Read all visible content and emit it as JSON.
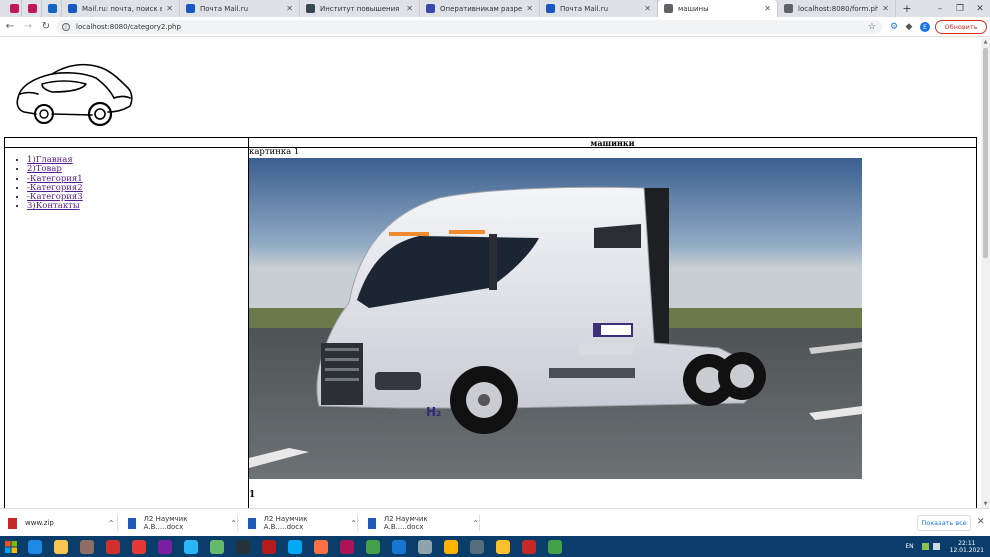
{
  "browser": {
    "tabs": [
      {
        "title": "",
        "color": "#c2185b"
      },
      {
        "title": "",
        "color": "#c2185b"
      },
      {
        "title": "",
        "color": "#1565c0"
      },
      {
        "title": "Mail.ru: почта, поиск в интерн",
        "color": "#1a56c4"
      },
      {
        "title": "Почта Mail.ru",
        "color": "#1a56c4"
      },
      {
        "title": "Институт повышения квалиф",
        "color": "#37474f"
      },
      {
        "title": "Оперативникам разрешен ос",
        "color": "#3949ab"
      },
      {
        "title": "Почта Mail.ru",
        "color": "#1a56c4"
      },
      {
        "title": "машины",
        "color": "#5f6368"
      },
      {
        "title": "localhost:8080/form.php",
        "color": "#5f6368"
      }
    ],
    "active_tab_index": 8,
    "url": "localhost:8080/category2.php",
    "profile_initial": "E",
    "update_label": "Обновить"
  },
  "page": {
    "table_header": "машинки",
    "menu": [
      "1)Главная",
      "2)Товар",
      "-Категория1",
      "-Категория2",
      "-Категория3",
      "3)Контакты"
    ],
    "picture_caption": "картинка 1",
    "footer_number": "1",
    "truck_badge": "H₂"
  },
  "downloads": {
    "items": [
      {
        "name": "www.zip",
        "icon_color": "#c62828"
      },
      {
        "name": "Л2 Наумчик А.В.....docx",
        "icon_color": "#1e5bb8"
      },
      {
        "name": "Л2 Наумчик А.В.....docx",
        "icon_color": "#1e5bb8"
      },
      {
        "name": "Л2 Наумчик А.В.....docx",
        "icon_color": "#1e5bb8"
      }
    ],
    "show_all_label": "Показать все"
  },
  "taskbar": {
    "language": "EN",
    "time": "22:11",
    "date": "12.01.2021",
    "apps": [
      {
        "name": "ie-icon",
        "color": "#1e88e5"
      },
      {
        "name": "explorer-icon",
        "color": "#f9c74f"
      },
      {
        "name": "media-icon",
        "color": "#8d6e63"
      },
      {
        "name": "opera-icon",
        "color": "#d32f2f"
      },
      {
        "name": "opera-gx-icon",
        "color": "#e53935"
      },
      {
        "name": "viber-icon",
        "color": "#7b1fa2"
      },
      {
        "name": "telegram-icon",
        "color": "#29b6f6"
      },
      {
        "name": "notepad-icon",
        "color": "#66bb6a"
      },
      {
        "name": "ccleaner-icon",
        "color": "#263238"
      },
      {
        "name": "recorder-icon",
        "color": "#b71c1c"
      },
      {
        "name": "skype-icon",
        "color": "#03a9f4"
      },
      {
        "name": "firefox-icon",
        "color": "#ff7043"
      },
      {
        "name": "winrar-icon",
        "color": "#ad1457"
      },
      {
        "name": "chrome-icon",
        "color": "#43a047"
      },
      {
        "name": "vscode-icon",
        "color": "#1976d2"
      },
      {
        "name": "settings-icon",
        "color": "#90a4ae"
      },
      {
        "name": "star-icon",
        "color": "#ffb300"
      },
      {
        "name": "photos-icon",
        "color": "#546e7a"
      },
      {
        "name": "paint-icon",
        "color": "#fbc02d"
      },
      {
        "name": "archive-icon",
        "color": "#c62828"
      },
      {
        "name": "editor-icon",
        "color": "#43a047"
      }
    ]
  }
}
